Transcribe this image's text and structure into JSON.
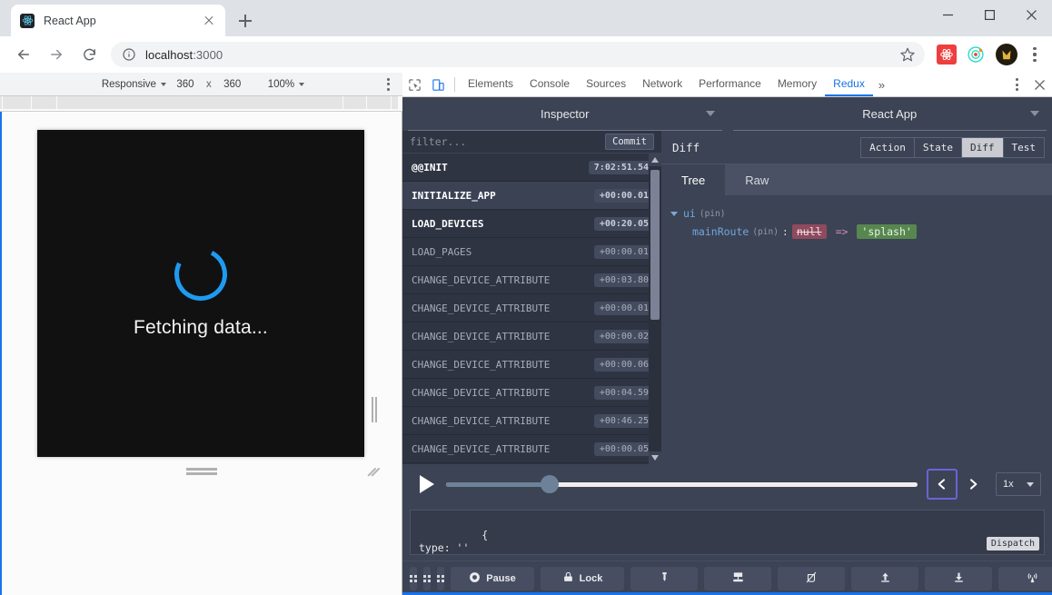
{
  "browser": {
    "tab": {
      "title": "React App",
      "favicon": "react-logo-icon",
      "close": "close-icon"
    },
    "new_tab_label": "+",
    "window": {
      "minimize": "minimize-icon",
      "maximize": "maximize-icon",
      "close": "close-icon"
    },
    "nav": {
      "back": "back-arrow-icon",
      "forward": "forward-arrow-icon",
      "reload": "reload-icon"
    },
    "omnibox": {
      "info_icon": "info-circle-icon",
      "url_host": "localhost",
      "url_port": ":3000",
      "star_icon": "bookmark-star-icon"
    },
    "extensions": [
      {
        "name": "react-devtools-extension-icon"
      },
      {
        "name": "redux-devtools-extension-icon"
      }
    ],
    "profile": "avatar",
    "menu": "kebab-menu-icon"
  },
  "device_toolbar": {
    "device_label": "Responsive",
    "width": "360",
    "x_separator": "x",
    "height": "360",
    "zoom": "100%",
    "menu": "kebab-menu-icon"
  },
  "page": {
    "loading_text": "Fetching data...",
    "spinner": "loading-spinner-icon"
  },
  "devtools": {
    "inspect_icon": "inspect-element-icon",
    "device_toggle_icon": "device-toolbar-icon",
    "tabs": [
      {
        "label": "Elements",
        "active": false
      },
      {
        "label": "Console",
        "active": false
      },
      {
        "label": "Sources",
        "active": false
      },
      {
        "label": "Network",
        "active": false
      },
      {
        "label": "Performance",
        "active": false
      },
      {
        "label": "Memory",
        "active": false
      },
      {
        "label": "Redux",
        "active": true
      }
    ],
    "more_tabs": "»",
    "settings_menu": "kebab-menu-icon",
    "close": "close-icon"
  },
  "redux": {
    "monitor_select": "Inspector",
    "instance_select": "React App",
    "filter_placeholder": "filter...",
    "commit_label": "Commit",
    "actions": [
      {
        "name": "@@INIT",
        "time": "7:02:51.54",
        "skipped": true,
        "selected": false
      },
      {
        "name": "INITIALIZE_APP",
        "time": "+00:00.01",
        "skipped": true,
        "selected": true
      },
      {
        "name": "LOAD_DEVICES",
        "time": "+00:20.05",
        "skipped": true,
        "selected": false
      },
      {
        "name": "LOAD_PAGES",
        "time": "+00:00.01",
        "skipped": false,
        "selected": false
      },
      {
        "name": "CHANGE_DEVICE_ATTRIBUTE",
        "time": "+00:03.80",
        "skipped": false,
        "selected": false
      },
      {
        "name": "CHANGE_DEVICE_ATTRIBUTE",
        "time": "+00:00.01",
        "skipped": false,
        "selected": false
      },
      {
        "name": "CHANGE_DEVICE_ATTRIBUTE",
        "time": "+00:00.02",
        "skipped": false,
        "selected": false
      },
      {
        "name": "CHANGE_DEVICE_ATTRIBUTE",
        "time": "+00:00.06",
        "skipped": false,
        "selected": false
      },
      {
        "name": "CHANGE_DEVICE_ATTRIBUTE",
        "time": "+00:04.59",
        "skipped": false,
        "selected": false
      },
      {
        "name": "CHANGE_DEVICE_ATTRIBUTE",
        "time": "+00:46.25",
        "skipped": false,
        "selected": false
      },
      {
        "name": "CHANGE_DEVICE_ATTRIBUTE",
        "time": "+00:00.05",
        "skipped": false,
        "selected": false
      }
    ],
    "inspector": {
      "title": "Diff",
      "tabs": [
        {
          "label": "Action",
          "active": false
        },
        {
          "label": "State",
          "active": false
        },
        {
          "label": "Diff",
          "active": true
        },
        {
          "label": "Test",
          "active": false
        }
      ],
      "subtabs": [
        {
          "label": "Tree",
          "active": true
        },
        {
          "label": "Raw",
          "active": false
        }
      ],
      "tree": {
        "root_key": "ui",
        "root_pin": "(pin)",
        "child_key": "mainRoute",
        "child_pin": "(pin)",
        "colon": ":",
        "old_value": "null",
        "arrow": "=>",
        "new_value": "'splash'"
      }
    },
    "playback": {
      "play_icon": "play-icon",
      "slider_percent": 22,
      "prev_icon": "chevron-left-icon",
      "next_icon": "chevron-right-icon",
      "speed": "1x"
    },
    "dispatcher": {
      "value": "{\ntype: ''\n}",
      "dispatch_label": "Dispatch"
    },
    "bottom_toolbar": [
      {
        "name": "layout-vertical-button",
        "label": "",
        "icon": "grid-icon"
      },
      {
        "name": "layout-horizontal-button",
        "label": "",
        "icon": "grid-icon"
      },
      {
        "name": "layout-auto-button",
        "label": "",
        "icon": "grid-icon"
      },
      {
        "name": "pause-button",
        "label": "Pause",
        "icon": "record-circle-icon"
      },
      {
        "name": "lock-button",
        "label": "Lock",
        "icon": "padlock-icon"
      },
      {
        "name": "pin-button",
        "label": "",
        "icon": "pin-icon"
      },
      {
        "name": "persist-button",
        "label": "",
        "icon": "stamp-icon"
      },
      {
        "name": "disable-button",
        "label": "",
        "icon": "slash-circle-icon"
      },
      {
        "name": "import-button",
        "label": "",
        "icon": "upload-icon"
      },
      {
        "name": "export-button",
        "label": "",
        "icon": "download-icon"
      },
      {
        "name": "remote-button",
        "label": "",
        "icon": "broadcast-icon"
      },
      {
        "name": "settings-button",
        "label": "",
        "icon": "gear-icon"
      }
    ]
  },
  "colors": {
    "accent_blue": "#1a73e8",
    "panel_bg": "#3c4354",
    "list_bg": "#2f3443",
    "diff_old": "#8f4a5e",
    "diff_new": "#57874f",
    "focus_ring": "#6a63d8"
  }
}
